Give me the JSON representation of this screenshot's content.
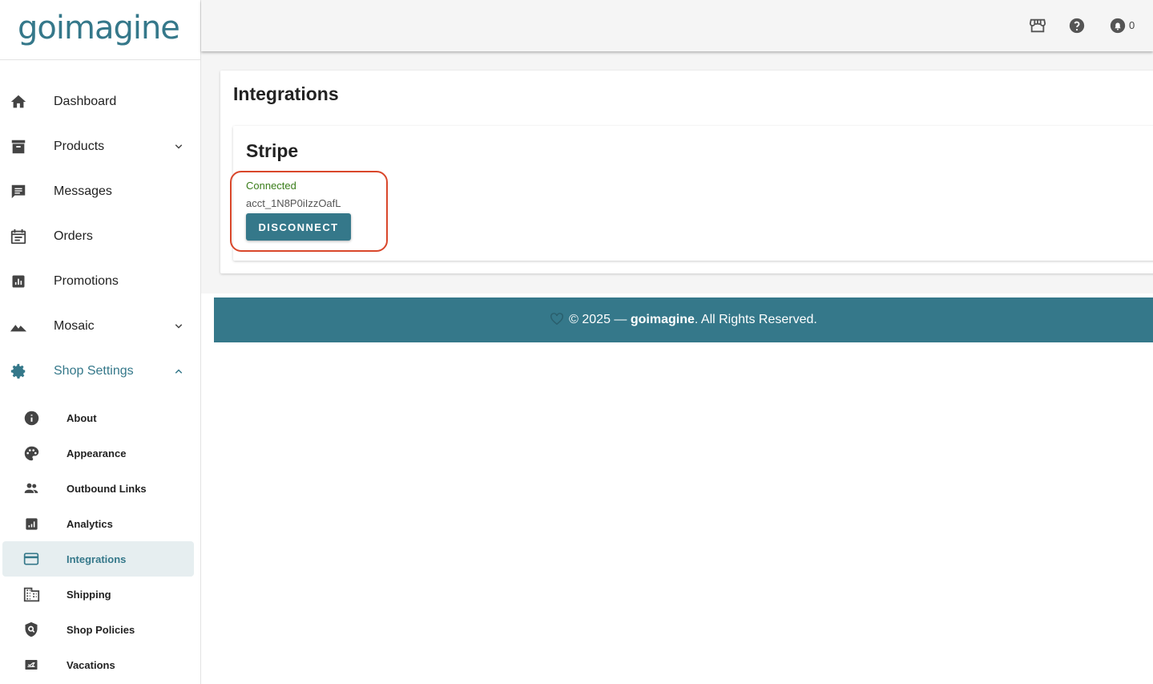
{
  "brand": {
    "logo_text": "goimagine"
  },
  "sidebar": {
    "items": [
      {
        "label": "Dashboard",
        "icon": "home-icon"
      },
      {
        "label": "Products",
        "icon": "archive-icon",
        "expandable": true
      },
      {
        "label": "Messages",
        "icon": "message-icon"
      },
      {
        "label": "Orders",
        "icon": "calendar-icon"
      },
      {
        "label": "Promotions",
        "icon": "chart-icon"
      },
      {
        "label": "Mosaic",
        "icon": "mountain-icon",
        "expandable": true
      },
      {
        "label": "Shop Settings",
        "icon": "gear-icon",
        "expanded": true
      }
    ],
    "sub_items": [
      {
        "label": "About",
        "icon": "info-icon"
      },
      {
        "label": "Appearance",
        "icon": "palette-icon"
      },
      {
        "label": "Outbound Links",
        "icon": "people-icon"
      },
      {
        "label": "Analytics",
        "icon": "analytics-icon"
      },
      {
        "label": "Integrations",
        "icon": "credit-card-icon",
        "selected": true
      },
      {
        "label": "Shipping",
        "icon": "building-icon"
      },
      {
        "label": "Shop Policies",
        "icon": "shield-icon"
      },
      {
        "label": "Vacations",
        "icon": "flight-icon"
      }
    ]
  },
  "topbar": {
    "icons": [
      "store-icon",
      "help-icon",
      "bell-icon"
    ],
    "notification_count": "0"
  },
  "page": {
    "title": "Integrations",
    "stripe": {
      "title": "Stripe",
      "status": "Connected",
      "account_id": "acct_1N8P0iIzzOafL",
      "disconnect_label": "DISCONNECT"
    }
  },
  "footer": {
    "prefix": "© 2025 —",
    "brand": "goimagine",
    "suffix": ". All Rights Reserved."
  },
  "colors": {
    "accent": "#35788a",
    "connected": "#3a7d1a",
    "highlight": "#d9472b"
  }
}
